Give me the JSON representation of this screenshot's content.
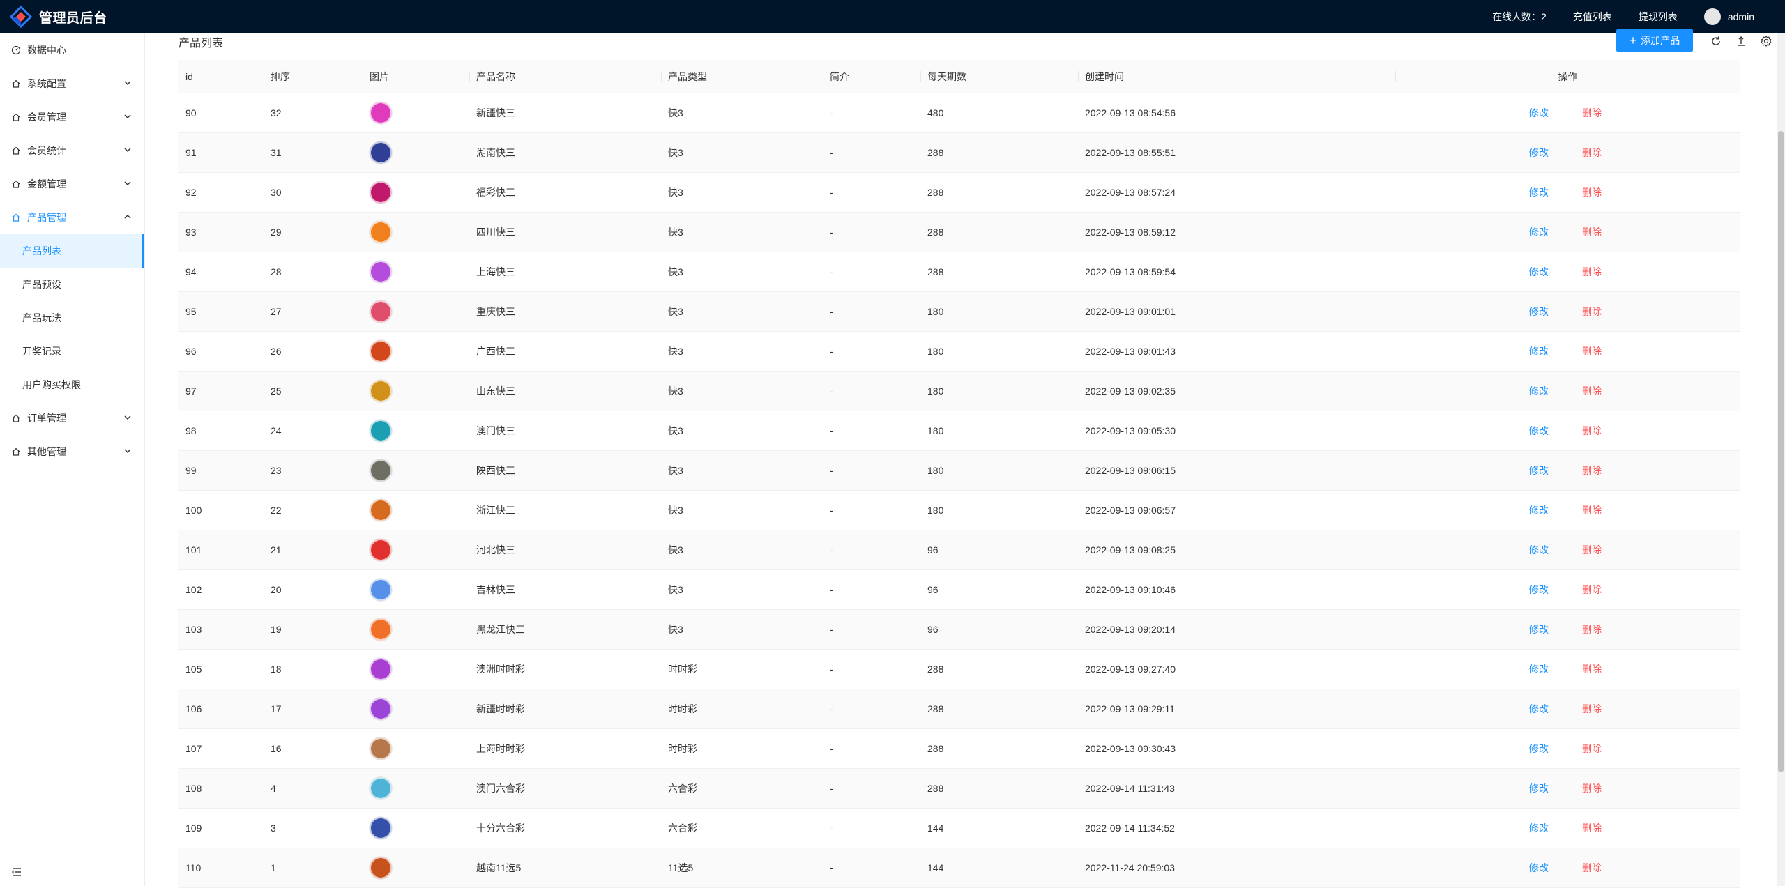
{
  "header": {
    "title": "管理员后台",
    "online": "在线人数：2",
    "recharge": "充值列表",
    "withdraw": "提现列表",
    "username": "admin",
    "bg_color": "#001529"
  },
  "sidebar": {
    "items": [
      {
        "label": "数据中心"
      },
      {
        "label": "系统配置"
      },
      {
        "label": "会员管理"
      },
      {
        "label": "会员统计"
      },
      {
        "label": "金额管理"
      },
      {
        "label": "产品管理"
      },
      {
        "label": "订单管理"
      },
      {
        "label": "其他管理"
      }
    ],
    "sub_items": [
      {
        "label": "产品列表"
      },
      {
        "label": "产品预设"
      },
      {
        "label": "产品玩法"
      },
      {
        "label": "开奖记录"
      },
      {
        "label": "用户购买权限"
      }
    ],
    "accent": "#1890ff"
  },
  "main": {
    "title": "产品列表",
    "add_button": "添加产品",
    "columns": [
      "id",
      "排序",
      "图片",
      "产品名称",
      "产品类型",
      "简介",
      "每天期数",
      "创建时间",
      "操作"
    ],
    "edit_label": "修改",
    "delete_label": "删除",
    "rows": [
      {
        "id": "90",
        "sort": "32",
        "name": "新疆快三",
        "type": "快3",
        "intro": "-",
        "daily": "480",
        "created": "2022-09-13 08:54:56",
        "color": "#e03bbd"
      },
      {
        "id": "91",
        "sort": "31",
        "name": "湖南快三",
        "type": "快3",
        "intro": "-",
        "daily": "288",
        "created": "2022-09-13 08:55:51",
        "color": "#2f3f96"
      },
      {
        "id": "92",
        "sort": "30",
        "name": "福彩快三",
        "type": "快3",
        "intro": "-",
        "daily": "288",
        "created": "2022-09-13 08:57:24",
        "color": "#c0186b"
      },
      {
        "id": "93",
        "sort": "29",
        "name": "四川快三",
        "type": "快3",
        "intro": "-",
        "daily": "288",
        "created": "2022-09-13 08:59:12",
        "color": "#f07f1e"
      },
      {
        "id": "94",
        "sort": "28",
        "name": "上海快三",
        "type": "快3",
        "intro": "-",
        "daily": "288",
        "created": "2022-09-13 08:59:54",
        "color": "#b44ddb"
      },
      {
        "id": "95",
        "sort": "27",
        "name": "重庆快三",
        "type": "快3",
        "intro": "-",
        "daily": "180",
        "created": "2022-09-13 09:01:01",
        "color": "#df4e6a"
      },
      {
        "id": "96",
        "sort": "26",
        "name": "广西快三",
        "type": "快3",
        "intro": "-",
        "daily": "180",
        "created": "2022-09-13 09:01:43",
        "color": "#d3471c"
      },
      {
        "id": "97",
        "sort": "25",
        "name": "山东快三",
        "type": "快3",
        "intro": "-",
        "daily": "180",
        "created": "2022-09-13 09:02:35",
        "color": "#d1901a"
      },
      {
        "id": "98",
        "sort": "24",
        "name": "澳门快三",
        "type": "快3",
        "intro": "-",
        "daily": "180",
        "created": "2022-09-13 09:05:30",
        "color": "#1d9fb3"
      },
      {
        "id": "99",
        "sort": "23",
        "name": "陕西快三",
        "type": "快3",
        "intro": "-",
        "daily": "180",
        "created": "2022-09-13 09:06:15",
        "color": "#6e6e62"
      },
      {
        "id": "100",
        "sort": "22",
        "name": "浙江快三",
        "type": "快3",
        "intro": "-",
        "daily": "180",
        "created": "2022-09-13 09:06:57",
        "color": "#d66b1f"
      },
      {
        "id": "101",
        "sort": "21",
        "name": "河北快三",
        "type": "快3",
        "intro": "-",
        "daily": "96",
        "created": "2022-09-13 09:08:25",
        "color": "#e0312f"
      },
      {
        "id": "102",
        "sort": "20",
        "name": "吉林快三",
        "type": "快3",
        "intro": "-",
        "daily": "96",
        "created": "2022-09-13 09:10:46",
        "color": "#5690e8"
      },
      {
        "id": "103",
        "sort": "19",
        "name": "黑龙江快三",
        "type": "快3",
        "intro": "-",
        "daily": "96",
        "created": "2022-09-13 09:20:14",
        "color": "#f0702a"
      },
      {
        "id": "105",
        "sort": "18",
        "name": "澳洲时时彩",
        "type": "时时彩",
        "intro": "-",
        "daily": "288",
        "created": "2022-09-13 09:27:40",
        "color": "#a83fd0"
      },
      {
        "id": "106",
        "sort": "17",
        "name": "新疆时时彩",
        "type": "时时彩",
        "intro": "-",
        "daily": "288",
        "created": "2022-09-13 09:29:11",
        "color": "#9b44d6"
      },
      {
        "id": "107",
        "sort": "16",
        "name": "上海时时彩",
        "type": "时时彩",
        "intro": "-",
        "daily": "288",
        "created": "2022-09-13 09:30:43",
        "color": "#b6784a"
      },
      {
        "id": "108",
        "sort": "4",
        "name": "澳门六合彩",
        "type": "六合彩",
        "intro": "-",
        "daily": "288",
        "created": "2022-09-14 11:31:43",
        "color": "#4fb3d8"
      },
      {
        "id": "109",
        "sort": "3",
        "name": "十分六合彩",
        "type": "六合彩",
        "intro": "-",
        "daily": "144",
        "created": "2022-09-14 11:34:52",
        "color": "#3450a8"
      },
      {
        "id": "110",
        "sort": "1",
        "name": "越南11选5",
        "type": "11选5",
        "intro": "-",
        "daily": "144",
        "created": "2022-11-24 20:59:03",
        "color": "#c7521e"
      }
    ]
  }
}
